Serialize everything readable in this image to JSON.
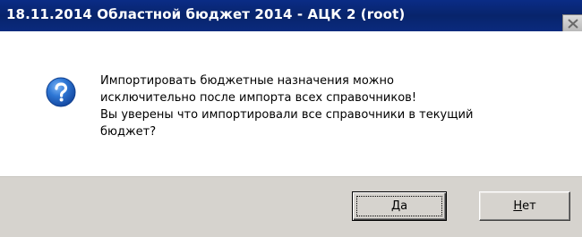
{
  "window": {
    "title": "18.11.2014 Областной бюджет 2014 - АЦК 2 (root)"
  },
  "dialog": {
    "icon": "question-icon",
    "message_lines": [
      "Импортировать бюджетные назначения можно",
      "исключительно после импорта всех справочников!",
      "Вы уверены что импортировали все справочники в текущий",
      "бюджет?"
    ]
  },
  "buttons": {
    "yes": {
      "hotkey": "Д",
      "rest": "а"
    },
    "no": {
      "hotkey": "Н",
      "rest": "ет"
    }
  },
  "colors": {
    "title_bar": "#0a2a7e",
    "footer": "#d6d3ce",
    "icon": "#1e5bb8"
  }
}
